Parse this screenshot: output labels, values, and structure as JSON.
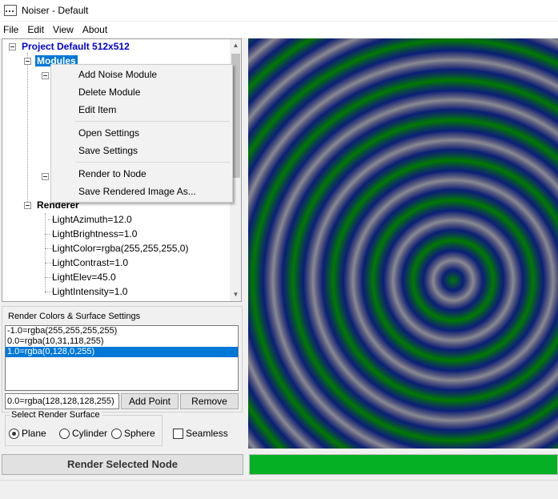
{
  "window": {
    "title": "Noiser - Default"
  },
  "menu": [
    "File",
    "Edit",
    "View",
    "About"
  ],
  "tree": {
    "project": "Project Default 512x512",
    "modules": "Modules",
    "renderer": "Renderer",
    "renderer_items": [
      "LightAzimuth=12.0",
      "LightBrightness=1.0",
      "LightColor=rgba(255,255,255,0)",
      "LightContrast=1.0",
      "LightElev=45.0",
      "LightIntensity=1.0"
    ]
  },
  "context_menu": {
    "items": [
      "Add Noise Module",
      "Delete Module",
      "Edit Item",
      "Open Settings",
      "Save Settings",
      "Render to Node",
      "Save Rendered Image As..."
    ]
  },
  "colors_group": {
    "title": "Render Colors & Surface Settings",
    "list": [
      "-1.0=rgba(255,255,255,255)",
      "0.0=rgba(10,31,118,255)",
      "1.0=rgba(0,128,0,255)"
    ],
    "selected_index": 2,
    "input_value": "0.0=rgba(128,128,128,255)",
    "add_label": "Add Point",
    "remove_label": "Remove"
  },
  "surface_group": {
    "title": "Select Render Surface",
    "options": [
      "Plane",
      "Cylinder",
      "Sphere"
    ],
    "selected": "Plane",
    "seamless_label": "Seamless",
    "seamless_checked": false
  },
  "render_button": "Render Selected Node",
  "progress": {
    "value": 1.0,
    "color": "#06b025"
  },
  "colors": {
    "selection": "#0078d7",
    "preview_dark": "#0a1f76",
    "preview_green": "#007a00"
  }
}
